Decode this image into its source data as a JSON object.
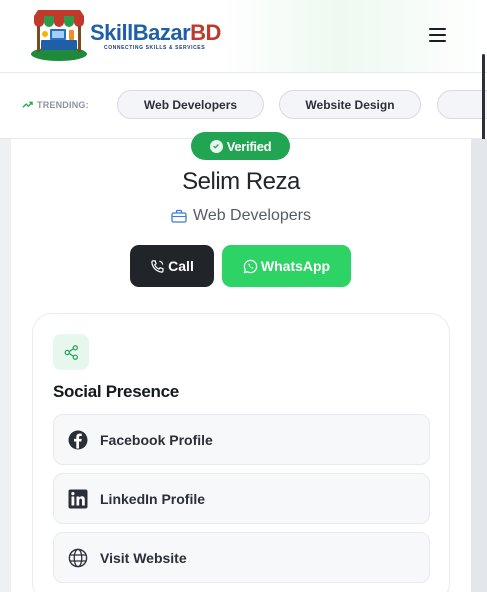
{
  "brand": {
    "skill": "Skill",
    "bazar": "Bazar",
    "bd": "BD",
    "tagline": "CONNECTING SKILLS & SERVICES",
    "colors": {
      "primary": "#1f5fa8",
      "accent": "#c0392b"
    }
  },
  "header": {
    "menu_icon": "hamburger-icon"
  },
  "trending": {
    "label": "TRENDING:",
    "icon": "trend-up-icon",
    "chips": [
      "Web Developers",
      "Website Design"
    ]
  },
  "profile": {
    "verified_label": "Verified",
    "name": "Selim Reza",
    "category": "Web Developers",
    "category_icon": "briefcase-icon",
    "call_label": "Call",
    "whatsapp_label": "WhatsApp",
    "colors": {
      "verified": "#22a552",
      "call": "#212429",
      "whatsapp": "#2ed366"
    }
  },
  "social": {
    "title": "Social Presence",
    "icon": "share-icon",
    "links": [
      {
        "label": "Facebook Profile",
        "icon": "facebook-icon"
      },
      {
        "label": "LinkedIn Profile",
        "icon": "linkedin-icon"
      },
      {
        "label": "Visit Website",
        "icon": "globe-icon"
      }
    ]
  }
}
